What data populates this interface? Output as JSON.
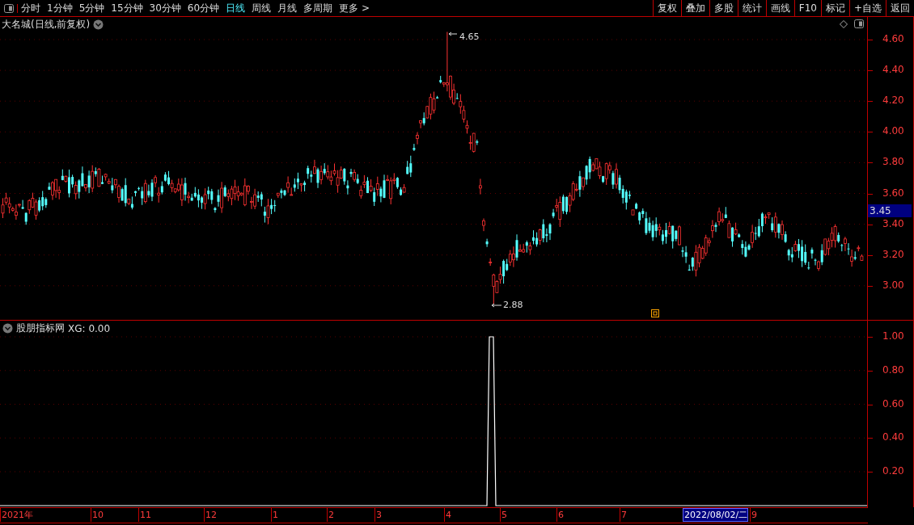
{
  "toolbar": {
    "periods": [
      {
        "label": "分时",
        "selected": false
      },
      {
        "label": "1分钟",
        "selected": false
      },
      {
        "label": "5分钟",
        "selected": false
      },
      {
        "label": "15分钟",
        "selected": false
      },
      {
        "label": "30分钟",
        "selected": false
      },
      {
        "label": "60分钟",
        "selected": false
      },
      {
        "label": "日线",
        "selected": true
      },
      {
        "label": "周线",
        "selected": false
      },
      {
        "label": "月线",
        "selected": false
      },
      {
        "label": "多周期",
        "selected": false
      },
      {
        "label": "更多 >",
        "selected": false
      }
    ],
    "actions": [
      "复权",
      "叠加",
      "多股",
      "统计",
      "画线",
      "F10",
      "标记",
      "+自选",
      "返回"
    ]
  },
  "price_chart": {
    "title": "大名城(日线,前复权)",
    "high_label": "4.65",
    "low_label": "2.88",
    "current_price": "3.45",
    "y_ticks": [
      "4.60",
      "4.40",
      "4.20",
      "4.00",
      "3.80",
      "3.60",
      "3.40",
      "3.20",
      "3.00"
    ]
  },
  "indicator": {
    "name": "股朋指标网",
    "reading": "XG: 0.00",
    "y_ticks": [
      "1.00",
      "0.80",
      "0.60",
      "0.40",
      "0.20"
    ]
  },
  "date_axis": [
    {
      "label": "2021年",
      "selected": false
    },
    {
      "label": "10",
      "selected": false
    },
    {
      "label": "11",
      "selected": false
    },
    {
      "label": "12",
      "selected": false
    },
    {
      "label": "1",
      "selected": false
    },
    {
      "label": "2",
      "selected": false
    },
    {
      "label": "3",
      "selected": false
    },
    {
      "label": "4",
      "selected": false
    },
    {
      "label": "5",
      "selected": false
    },
    {
      "label": "6",
      "selected": false
    },
    {
      "label": "7",
      "selected": false
    },
    {
      "label": "2022/08/02/二",
      "selected": true
    },
    {
      "label": "9",
      "selected": false
    }
  ]
}
